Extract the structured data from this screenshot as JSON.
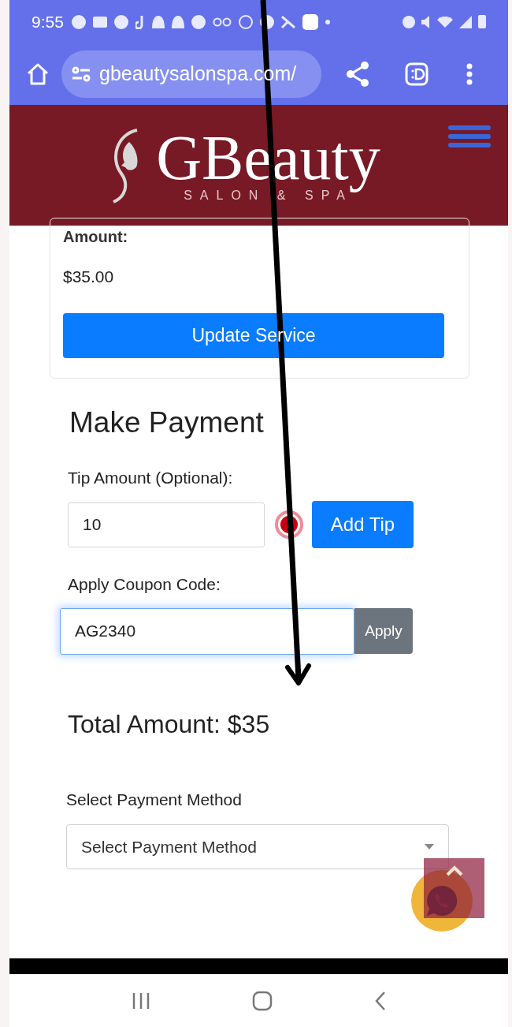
{
  "status_bar": {
    "time": "9:55"
  },
  "browser": {
    "url": "gbeautysalonspa.com/"
  },
  "header": {
    "logo_name": "GBeauty",
    "logo_tagline": "SALON & SPA"
  },
  "service_card": {
    "amount_label": "Amount:",
    "amount": "$35.00",
    "button": "Update Service"
  },
  "payment": {
    "title": "Make Payment",
    "tip_label": "Tip Amount (Optional):",
    "tip_value": "10",
    "add_tip_button": "Add Tip",
    "coupon_label": "Apply Coupon Code:",
    "coupon_value": "AG2340",
    "coupon_focused": true,
    "apply_button": "Apply",
    "total": "Total Amount: $35",
    "method_label": "Select Payment Method",
    "method_select": "Select Payment Method"
  }
}
